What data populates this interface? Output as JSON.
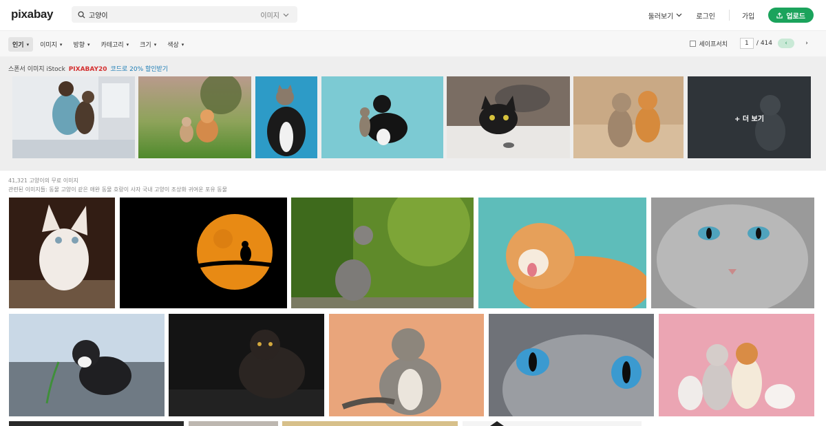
{
  "header": {
    "logo": "pixabay",
    "search_value": "고양이",
    "search_type": "이미지",
    "nav": {
      "explore": "둘러보기",
      "login": "로그인",
      "join": "가입",
      "upload": "업로드"
    }
  },
  "filterbar": {
    "filters": [
      "인기",
      "이미지",
      "방향",
      "카테고리",
      "크기",
      "색상"
    ],
    "safesearch_label": "세이프서치",
    "page_current": "1",
    "page_total": "/ 414"
  },
  "sponsor": {
    "text_prefix": "스폰서 이미지 iStock",
    "code": "PIXABAY20",
    "text_suffix": "코드로 20% 할인받기",
    "more_label": "+ 더 보기"
  },
  "results": {
    "count_text": "41,321 고양이의 무료 이미지",
    "related_text": "관련된 이미지들: 동물 고양이 같은 애완 동물 호랑이 사자 국내 고양이 조상화 귀여운 포유 동물"
  },
  "colors": {
    "brand_green": "#1ba35c",
    "promo_red": "#d42f2f",
    "link_blue": "#1d7db5"
  }
}
